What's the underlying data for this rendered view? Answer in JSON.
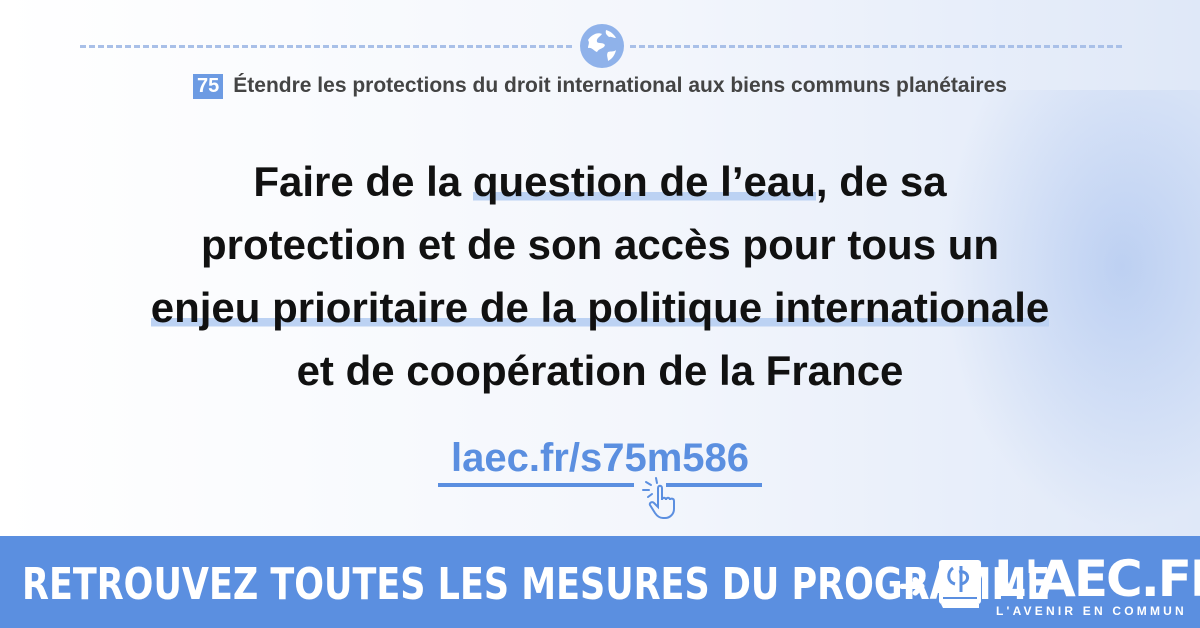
{
  "colors": {
    "accent": "#5b8fe0",
    "highlight": "#bcd2f3",
    "text": "#111111"
  },
  "header": {
    "icon": "globe-icon",
    "number": "75",
    "title": "Étendre les protections du droit international aux biens communs planétaires"
  },
  "headline": {
    "l1a": "Faire de la ",
    "l1b": "question de l’eau",
    "l1c": ", de sa",
    "l2": "protection et de son accès pour tous un",
    "l3": "enjeu prioritaire de la politique internationale",
    "l4": "et de coopération de la France"
  },
  "link": {
    "text": "laec.fr/s75m586",
    "icon": "pointing-hand-icon"
  },
  "banner": {
    "text": "RETROUVEZ TOUTES LES MESURES DU PROGRAMME",
    "arrow": "➜",
    "logo_main": "L'AEC.FR",
    "logo_sub": "L'AVENIR EN COMMUN"
  }
}
